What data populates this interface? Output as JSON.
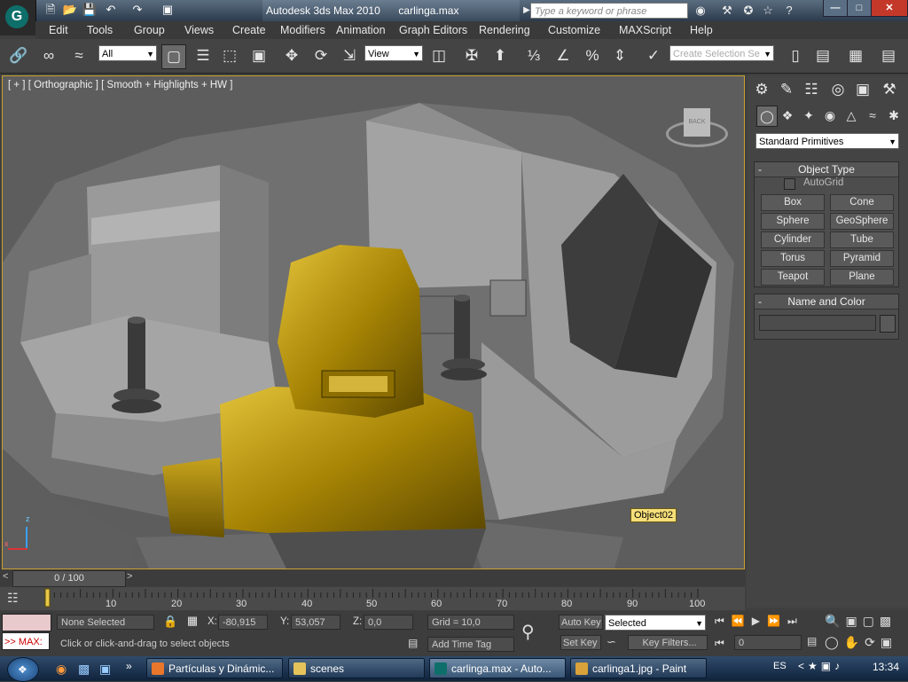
{
  "titlebar": {
    "title": "Autodesk 3ds Max  2010",
    "filename": "carlinga.max",
    "search_placeholder": "Type a keyword or phrase"
  },
  "menu": [
    "Edit",
    "Tools",
    "Group",
    "Views",
    "Create",
    "Modifiers",
    "Animation",
    "Graph Editors",
    "Rendering",
    "Customize",
    "MAXScript",
    "Help"
  ],
  "toolbar": {
    "selection_filter": "All",
    "ref_coord": "View",
    "named_selection": "Create Selection Se"
  },
  "viewport": {
    "label": "[ + ] [ Orthographic ] [ Smooth + Highlights + HW ]",
    "object_tooltip": "Object02",
    "viewcube_label": "BACK",
    "axis_x": "x",
    "axis_z": "z"
  },
  "command_panel": {
    "category": "Standard Primitives",
    "object_type_title": "Object Type",
    "autogrid_label": "AutoGrid",
    "buttons": [
      "Box",
      "Cone",
      "Sphere",
      "GeoSphere",
      "Cylinder",
      "Tube",
      "Torus",
      "Pyramid",
      "Teapot",
      "Plane"
    ],
    "name_color_title": "Name and Color",
    "name_value": ""
  },
  "timeline": {
    "frame_display": "0 / 100",
    "ticks": [
      "10",
      "20",
      "30",
      "40",
      "50",
      "60",
      "70",
      "80",
      "90",
      "100"
    ]
  },
  "status": {
    "maxscript_label": ">> MAX:",
    "selection": "None Selected",
    "x_label": "X:",
    "x_value": "-80,915",
    "y_label": "Y:",
    "y_value": "53,057",
    "z_label": "Z:",
    "z_value": "0,0",
    "grid": "Grid = 10,0",
    "prompt": "Click or click-and-drag to select objects",
    "add_time_tag": "Add Time Tag",
    "auto_key": "Auto Key",
    "set_key": "Set Key",
    "key_mode": "Selected",
    "key_filters": "Key Filters...",
    "current_frame": "0"
  },
  "taskbar": {
    "tasks": [
      "Partículas y Dinámic...",
      "scenes",
      "carlinga.max - Auto...",
      "carlinga1.jpg - Paint"
    ],
    "lang": "ES",
    "clock": "13:34"
  },
  "colors": {
    "accent_yellow": "#c9a030",
    "pilot_gold": "#b8960a",
    "panel_bg": "#444444"
  }
}
